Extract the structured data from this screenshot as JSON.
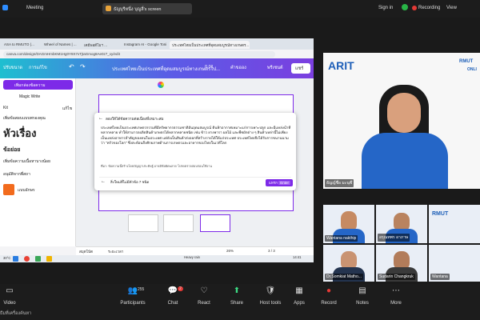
{
  "zoom": {
    "meeting_label": "Meeting",
    "share_label": "ธัญบุรีหนึ่ง บุญลี่'s screen",
    "sign_in": "Sign in",
    "recording": "Recording",
    "view": "View",
    "controls": [
      {
        "label": "Video",
        "icon": "video-icon"
      },
      {
        "label": "Participants",
        "icon": "participants-icon",
        "count": "255"
      },
      {
        "label": "Chat",
        "icon": "chat-icon",
        "count": "2"
      },
      {
        "label": "React",
        "icon": "react-icon"
      },
      {
        "label": "Share",
        "icon": "share-icon"
      },
      {
        "label": "Host tools",
        "icon": "host-tools-icon"
      },
      {
        "label": "Apps",
        "icon": "apps-icon"
      },
      {
        "label": "Record",
        "icon": "record-icon"
      },
      {
        "label": "Notes",
        "icon": "notes-icon"
      },
      {
        "label": "More",
        "icon": "more-icon"
      }
    ],
    "bottom_left_text": "ธีมที่เครื่องค้นหา"
  },
  "browser": {
    "tabs": [
      "ASA to RMUTO (...",
      "Wheel of Names | ...",
      "เคมีพอดีโมฯ ...",
      "Instagram AI - Google Tonif",
      "ประเทศไทยเป็นประเทศที่อุดมสมบูรณ์ทางเกษตร..."
    ],
    "url": "canva.com/design/DAGmHmbKM1Hg0Y8X7xTjtaGmog8Ae0z7_xy/edit"
  },
  "canva": {
    "menu_file": "ปรับขนาด",
    "menu_resize": "การแก้ไข",
    "doc_title": "ประเทศไทยเป็นประเทศที่อุดมสมบูรณ์ทางเกษตรไป...",
    "timer": "0.01",
    "zoom_word": "คำขออง",
    "share_label": "แชร์",
    "ai_label": "พรีเซนต์",
    "sidebar_header": "เพิ่มกล่องข้อความ",
    "magic_write": "Magic Write",
    "sidebar_kit": "Kit",
    "sidebar_edit": "แก้ไข",
    "sidebar_item1": "เพิ่มข้อสอบแบบพรองคุณ",
    "big_text": "หัวเรื่อง",
    "sidebar_item2": "ข้อย่อย",
    "sidebar_item3": "เพิ่มข้อความเนื้อหาบางน้อย",
    "sidebar_item4": "อนุมัติจากพี่สถา",
    "sidebar_item5": "แบบอักษร",
    "dialog_title": "ลองให้ได้ข้อความต่อเนื่องที่เหมาะสม",
    "dialog_body": "ประเทศไทยเป็นประเทศเกษตรกรรมที่มีทรัพยากรธรรมชาติอันอุดมสมบูรณ์ ดินฟ้าอากาศเหมาะแก่การเพาะปลูก และมีแหล่งน้ำที่หลากหลาย ทำให้สามารถผลิตสินค้าเกษตรได้หลากหลายชนิด เช่น ข้าว ยางพารา ผลไม้ และพืชผักต่าง ๆ สินค้าเหล่านี้ไม่เพียงเป็นแหล่งอาหารสำคัญของคนในประเทศ แต่ยังเป็นสินค้าส่งออกที่สร้างรายได้ให้แก่ประเทศ ประเทศไทยจึงได้รับการขนานนามว่า \"ครัวของโลก\" ซึ่งสะท้อนถึงศักยภาพด้านการเกษตรและอาหารของไทยในเวทีโลก",
    "dialog_source": "ที่มา: ข้อความนี้สร้างโดยปัญญาประดิษฐ์ อาจมีข้อผิดพลาด โปรดตรวจสอบก่อนใช้งาน",
    "dialog_footer_text": "สิ่งใหม่ที่ไม่มีหัวข้อ 7 ชนิด",
    "insert_label": "แทรก",
    "insert_extra": "Enter",
    "bottom_notes": "สมุดโน้ต",
    "bottom_timer": "ระยะเวลา",
    "bottom_zoom": "26%",
    "bottom_pages": "3 / 3",
    "taskbar_weather": "Heavy rain",
    "taskbar_time": "14:41",
    "taskbar_date": "7/04/2568",
    "taskbar_temp": "30°C"
  },
  "video": {
    "speaker_name": "ธัญญ์ชื่อ มะนุฬ์",
    "speaker_logo": "ARIT",
    "speaker_logo_sub": "RMUT",
    "speaker_logo_sub2": "ONLI",
    "tiles": [
      {
        "name": "Wantana nakthip"
      },
      {
        "name": "อรุณทพร อาภาษ"
      },
      {
        "name": "Dr.Somkiat Matho..."
      },
      {
        "name": "Sudarin Changkruk"
      },
      {
        "name": "Wantana"
      }
    ]
  }
}
